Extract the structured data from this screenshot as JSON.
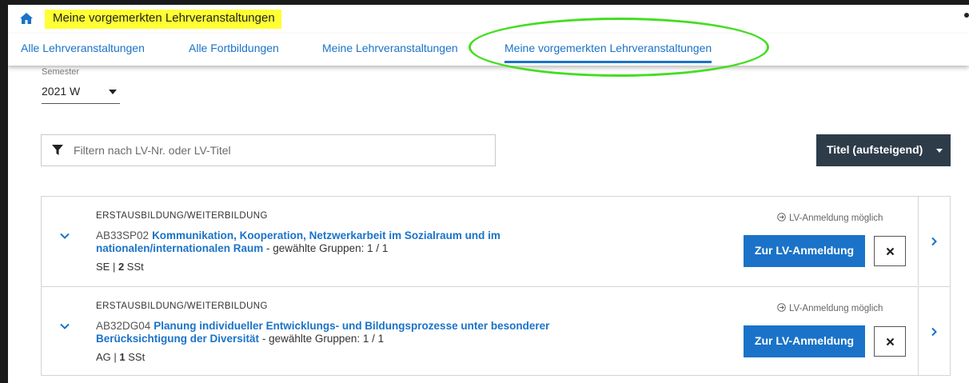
{
  "header": {
    "title": "Meine vorgemerkten Lehrveranstaltungen"
  },
  "tabs": [
    {
      "label": "Alle Lehrveranstaltungen",
      "active": false
    },
    {
      "label": "Alle Fortbildungen",
      "active": false
    },
    {
      "label": "Meine Lehrveranstaltungen",
      "active": false
    },
    {
      "label": "Meine vorgemerkten Lehrveranstaltungen",
      "active": true
    }
  ],
  "semester": {
    "label": "Semester",
    "value": "2021 W"
  },
  "filter": {
    "placeholder": "Filtern nach LV-Nr. oder LV-Titel"
  },
  "sort": {
    "label": "Titel (aufsteigend)"
  },
  "courses": [
    {
      "category": "ERSTAUSBILDUNG/WEITERBILDUNG",
      "code": "AB33SP02",
      "title": "Kommunikation, Kooperation, Netzwerkarbeit im Sozialraum und im nationalen/internationalen Raum",
      "separator": " - ",
      "groups_text": "gewählte Gruppen: 1 / 1",
      "type": "SE",
      "pipe": " | ",
      "sst_value": "2",
      "sst_unit": " SSt",
      "status": "LV-Anmeldung möglich",
      "register_label": "Zur LV-Anmeldung"
    },
    {
      "category": "ERSTAUSBILDUNG/WEITERBILDUNG",
      "code": "AB32DG04",
      "title": "Planung individueller Entwicklungs- und Bildungsprozesse unter besonderer Berücksichtigung der Diversität",
      "separator": " - ",
      "groups_text": "gewählte Gruppen: 1 / 1",
      "type": "AG",
      "pipe": " | ",
      "sst_value": "1",
      "sst_unit": " SSt",
      "status": "LV-Anmeldung möglich",
      "register_label": "Zur LV-Anmeldung"
    }
  ],
  "colors": {
    "accent": "#1a73c8",
    "dark_button": "#2e3c4a",
    "highlight_yellow": "#ffff33",
    "annotation_green": "#44dd22"
  },
  "icons": {
    "home": "home-icon",
    "filter": "filter-icon",
    "expand": "chevron-down-icon",
    "remove": "close-icon",
    "open": "chevron-right-icon",
    "status": "arrow-circle-right-icon"
  }
}
